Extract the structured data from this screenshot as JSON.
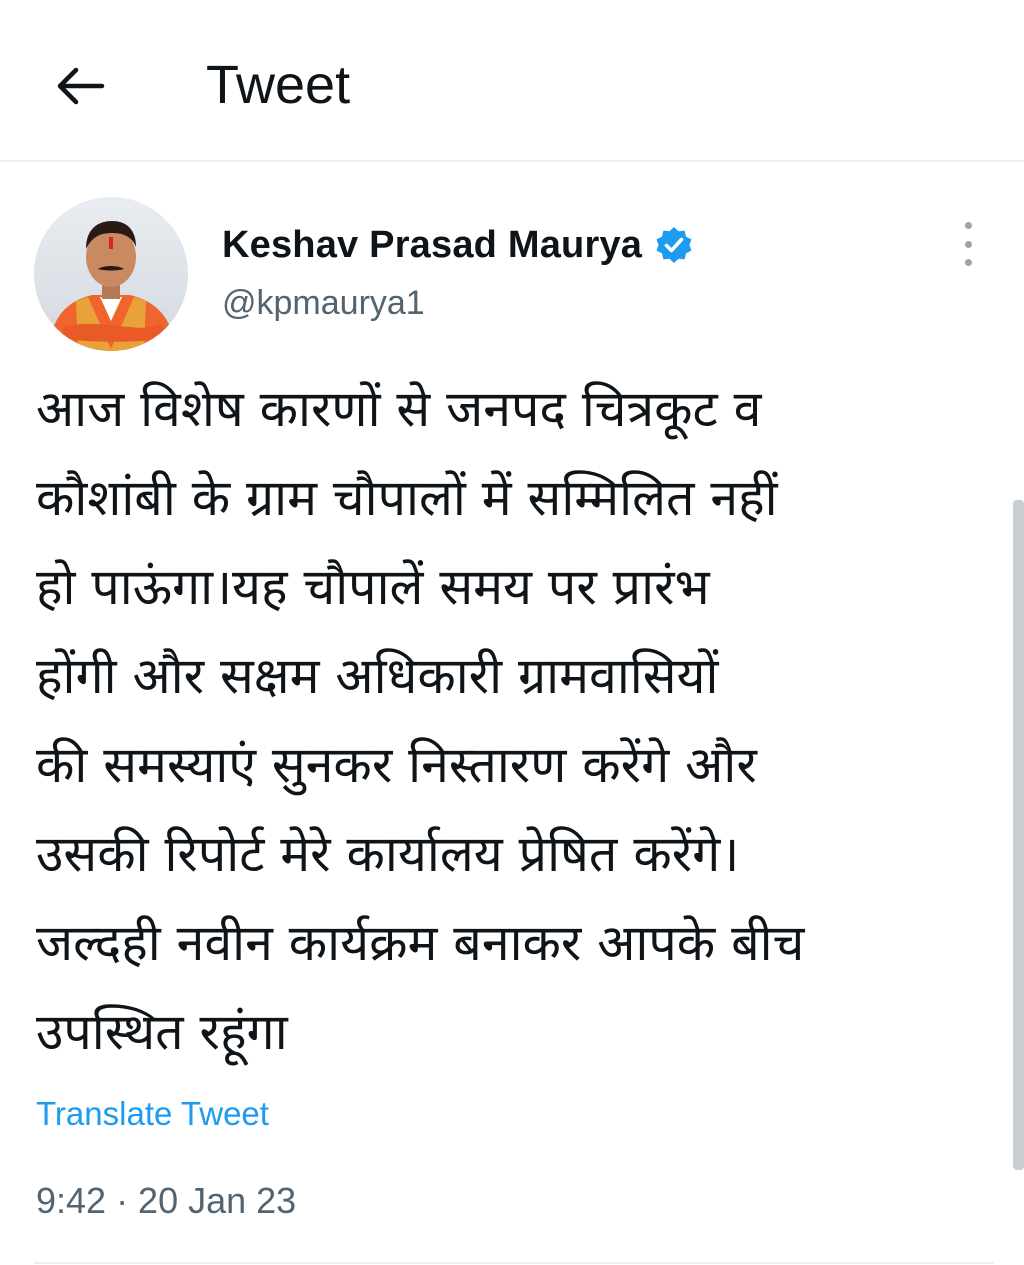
{
  "header": {
    "back_icon": "arrow-left-icon",
    "title": "Tweet"
  },
  "tweet": {
    "author": {
      "name": "Keshav Prasad Maurya",
      "handle": "@kpmaurya1",
      "verified": true,
      "verified_color": "#1d9bf0"
    },
    "text_lines": [
      "आज विशेष कारणों से जनपद चित्रकूट व",
      "कौशांबी के ग्राम चौपालों में सम्मिलित नहीं",
      "हो पाऊंगा।यह चौपालें समय पर प्रारंभ",
      "होंगी और सक्षम अधिकारी ग्रामवासियों",
      "की समस्याएं सुनकर निस्तारण करेंगे और",
      "उसकी रिपोर्ट मेरे कार्यालय प्रेषित करेंगे।",
      "जल्दही नवीन कार्यक्रम बनाकर आपके बीच",
      "उपस्थित रहूंगा"
    ],
    "translate_label": "Translate Tweet",
    "timestamp": "9:42 · 20 Jan 23"
  },
  "colors": {
    "accent": "#1d9bf0",
    "text_primary": "#0f1419",
    "text_secondary": "#536471",
    "divider": "#eceef0"
  }
}
